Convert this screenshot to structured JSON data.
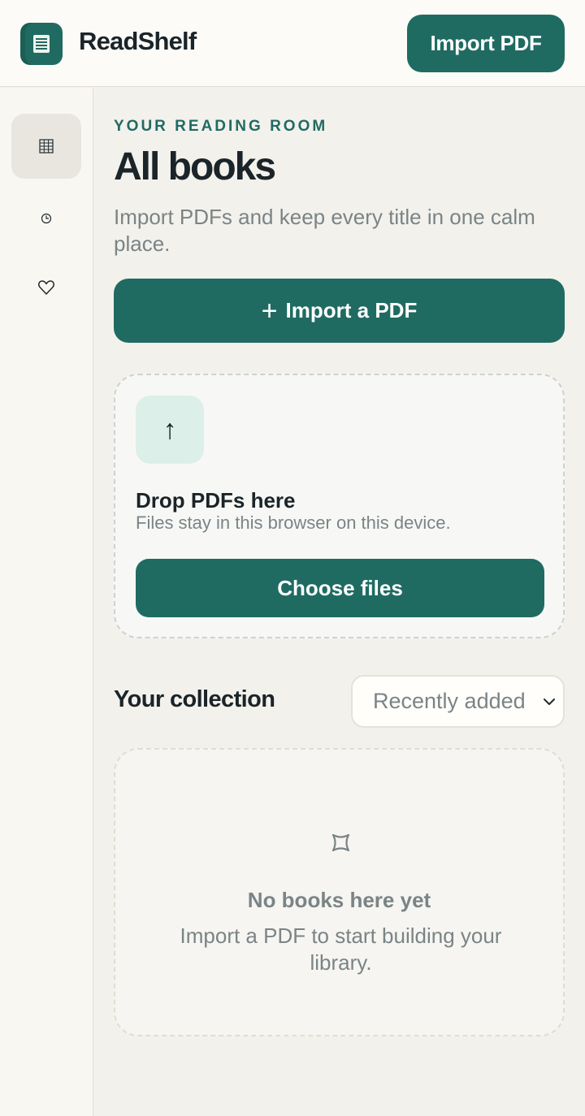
{
  "app": {
    "title": "ReadShelf",
    "logo_icon": "book-icon"
  },
  "header": {
    "import_button": "Import PDF"
  },
  "sidebar": {
    "items": [
      {
        "name": "library",
        "icon": "grid-icon",
        "active": true
      },
      {
        "name": "recent",
        "icon": "clock-icon",
        "active": false
      },
      {
        "name": "favorites",
        "icon": "heart-icon",
        "active": false
      }
    ]
  },
  "main": {
    "eyebrow": "YOUR READING ROOM",
    "title": "All books",
    "subtitle": "Import PDFs and keep every title in one calm place.",
    "import_button": {
      "icon": "+",
      "label": "Import a PDF"
    }
  },
  "dropzone": {
    "icon": "↑",
    "title": "Drop PDFs here",
    "subtitle": "Files stay in this browser on this device.",
    "choose_button": "Choose files"
  },
  "collection": {
    "title": "Your collection",
    "sort": {
      "selected": "Recently added"
    }
  },
  "empty_state": {
    "icon": "empty-shelf-icon",
    "title": "No books here yet",
    "subtitle": "Import a PDF to start building your library."
  },
  "colors": {
    "accent": "#1f6b62",
    "background": "#f3f1ec",
    "muted_text": "#7a8486",
    "upload_tile": "#dcefe9"
  }
}
